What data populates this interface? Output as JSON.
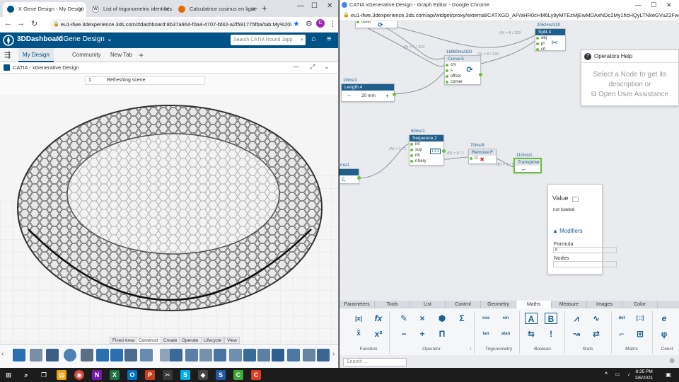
{
  "left_browser": {
    "tabs": [
      {
        "label": "X Gene Design - My Design",
        "color": "#005386"
      },
      {
        "label": "List of trigonometric identities",
        "color": "#555555"
      },
      {
        "label": "Calculatrice cosinus en ligne - C",
        "color": "#e66a00"
      }
    ],
    "url": "eu1-ifwe.3dexperience.3ds.com/#dashboard:8b37a964-f0a4-4707-bf42-a2f591775fba/tab:My%20Des..."
  },
  "dashboard": {
    "brand": "3DDashboard",
    "app": "X Gene Design",
    "search_placeholder": "Search CATIA Round Japp",
    "tabs": [
      "My Design",
      "Community",
      "New Tab"
    ],
    "panel_title": "CATIA - xGenerative Design",
    "refresh_num": "1",
    "refresh_text": "Refreshing scene"
  },
  "action_bar": {
    "tabs": [
      "Fixed Area",
      "Construct",
      "Create",
      "Operate",
      "Lifecycle",
      "View"
    ],
    "active_tab": "Construct"
  },
  "right_browser": {
    "title": "CATIA xGenerative Design - Graph Editor - Google Chrome",
    "url": "eu1-ifwe.3dexperience.3ds.com/api/widget/proxy/external/CATXGD_AP/aHR0cHM6Ly9yMTEzMjEwMDAxNDc2My1hcHQyLTNkeGVuZ2FwcHMuM..."
  },
  "graph": {
    "nodes": {
      "outer": {
        "label": "outer"
      },
      "split": {
        "time": "2052ms/320",
        "title": "Split.4",
        "ports": [
          "obj",
          "pl",
          "crl"
        ]
      },
      "curve": {
        "time": "16980ms/320",
        "title": "Curve.5",
        "ports": [
          "crv",
          "s",
          "offset",
          "corner"
        ]
      },
      "length": {
        "time": "10ms/1",
        "title": "Length.4",
        "value": "20 mm",
        "minus": "−",
        "plus": "+"
      },
      "sequence": {
        "time": "50ms/1",
        "title": "Sequence.2",
        "ports": [
          "inf",
          "sup",
          "nb",
          "nSery"
        ],
        "badge": "1.2.3"
      },
      "remove": {
        "time": "70ms/8",
        "title": "Remove F",
        "ports": [
          "l1"
        ]
      },
      "transpose": {
        "time": "110ms/1",
        "title": "Transpose"
      },
      "left_edge": {
        "time": "ms/1"
      }
    },
    "wire_labels": [
      "(A) = 8 / 320",
      "(A) = 1 / 320",
      "(A) = 8 / 320",
      "(A) = 1 / 1",
      "(B) = 8 / 1",
      "(B) = 1 / 1"
    ]
  },
  "help_panel": {
    "title": "Operators Help",
    "body_line1": "Select a Node to get its",
    "body_line2": "description or",
    "body_line3": "Open User Assistance"
  },
  "value_panel": {
    "label": "Value",
    "status": "not loaded",
    "modifiers": "Modifiers",
    "formula_label": "Formula",
    "formula_value": "X",
    "nodes_label": "Nodes",
    "nodes_value": ""
  },
  "operator_tabs": [
    "Parameters",
    "Tools",
    "List",
    "Control",
    "Geometry",
    "Maths",
    "Measure",
    "Images",
    "Color"
  ],
  "operator_active_tab": "Maths",
  "operator_groups": [
    "Function",
    "Operator",
    "Trigonometry",
    "Boolean",
    "Stats",
    "Matrix",
    "Const"
  ],
  "operator_icons": {
    "abs": "|x|",
    "fx": "fx",
    "xbar": "x̄",
    "pow": "x²",
    "sum": "Σ",
    "pi": "Π",
    "times": "×",
    "plus": "+",
    "minus": "−",
    "cos": "cos",
    "sin": "sin",
    "tan": "tan",
    "atan": "atan",
    "a_icon": "A",
    "b_icon": "B",
    "excl": "!",
    "det": "det",
    "matrix1": "[::]",
    "e": "e",
    "phi": "φ"
  },
  "search_placeholder": "Search ...",
  "taskbar": {
    "time": "8:35 PM",
    "date": "3/6/2021"
  }
}
